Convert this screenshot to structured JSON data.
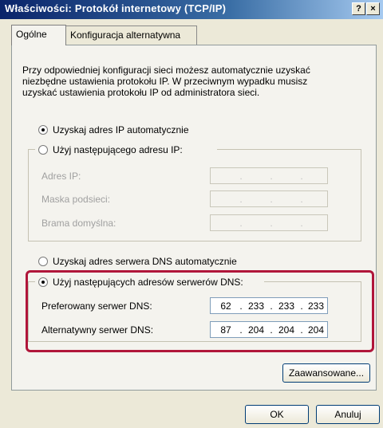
{
  "window": {
    "title": "Właściwości: Protokół internetowy (TCP/IP)"
  },
  "titlebar": {
    "help_label": "?",
    "close_label": "×"
  },
  "tabs": [
    {
      "label": "Ogólne",
      "active": true
    },
    {
      "label": "Konfiguracja alternatywna",
      "active": false
    }
  ],
  "info": {
    "line1": "Przy odpowiedniej konfiguracji sieci możesz automatycznie uzyskać",
    "line2": "niezbędne ustawienia protokołu IP. W przeciwnym wypadku musisz",
    "line3": "uzyskać ustawienia protokołu IP od administratora sieci."
  },
  "ip_mode": {
    "auto_label": "Uzyskaj adres IP automatycznie",
    "manual_label": "Użyj następującego adresu IP:",
    "selected": "auto"
  },
  "ip_fields": {
    "address_label": "Adres IP:",
    "mask_label": "Maska podsieci:",
    "gateway_label": "Brama domyślna:",
    "address_value": [
      "",
      "",
      "",
      ""
    ],
    "mask_value": [
      "",
      "",
      "",
      ""
    ],
    "gateway_value": [
      "",
      "",
      "",
      ""
    ]
  },
  "dns_mode": {
    "auto_label": "Uzyskaj adres serwera DNS automatycznie",
    "manual_label": "Użyj następujących adresów serwerów DNS:",
    "selected": "manual"
  },
  "dns_fields": {
    "preferred_label": "Preferowany serwer DNS:",
    "alternate_label": "Alternatywny serwer DNS:",
    "preferred": [
      "62",
      "233",
      "233",
      "233"
    ],
    "alternate": [
      "87",
      "204",
      "204",
      "204"
    ]
  },
  "separator": ".",
  "buttons": {
    "advanced": "Zaawansowane...",
    "ok": "OK",
    "cancel": "Anuluj"
  },
  "colors": {
    "titlebar_start": "#0a246a",
    "titlebar_end": "#a6caf0",
    "highlight_border": "#b0163a"
  }
}
